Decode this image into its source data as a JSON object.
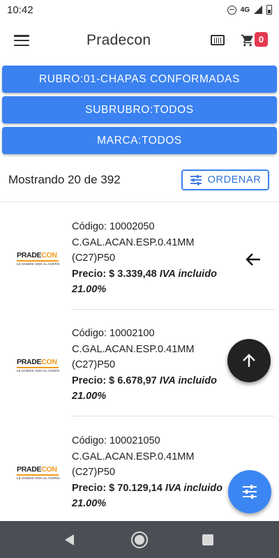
{
  "status_bar": {
    "time": "10:42",
    "network": "4G"
  },
  "app_bar": {
    "title": "Pradecon",
    "cart_count": "0"
  },
  "filters": {
    "rubro": "RUBRO:01-CHAPAS CONFORMADAS",
    "subrubro": "SUBRUBRO:TODOS",
    "marca": "MARCA:TODOS"
  },
  "results": {
    "summary": "Mostrando 20 de 392",
    "sort_label": "ORDENAR"
  },
  "logo": {
    "word_main": "PRADE",
    "word_accent": "CON",
    "tagline": "LE DAMOS VIDA AL ACERO"
  },
  "products": [
    {
      "code": "Código: 10002050",
      "name": "C.GAL.ACAN.ESP.0.41MM (C27)P50",
      "price": "Precio: $ 3.339,48",
      "iva": "IVA incluido 21.00%"
    },
    {
      "code": "Código: 10002100",
      "name": "C.GAL.ACAN.ESP.0.41MM (C27)P50",
      "price": "Precio: $ 6.678,97",
      "iva": "IVA incluido 21.00%"
    },
    {
      "code": "Código: 100021050",
      "name": "C.GAL.ACAN.ESP.0.41MM (C27)P50",
      "price": "Precio: $ 70.129,14",
      "iva": "IVA incluido 21.00%"
    }
  ],
  "colors": {
    "primary": "#3b82f0",
    "badge": "#e53950",
    "fab_dark": "#222222",
    "nav_bar": "#4b4f55",
    "logo_accent": "#f29a1a"
  },
  "icons": [
    "menu-icon",
    "barcode-icon",
    "cart-icon",
    "sort-sliders-icon",
    "arrow-left-icon",
    "arrow-up-icon",
    "filter-sliders-icon",
    "nav-back-icon",
    "nav-home-icon",
    "nav-recent-icon"
  ]
}
